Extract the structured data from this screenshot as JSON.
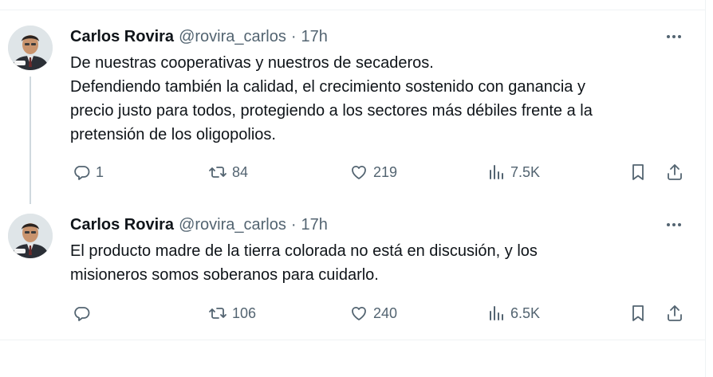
{
  "tweets": [
    {
      "author_name": "Carlos Rovira",
      "handle": "@rovira_carlos",
      "separator": "·",
      "time": "17h",
      "lines": [
        "De nuestras cooperativas y nuestros de secaderos.",
        "Defendiendo también la calidad, el crecimiento sostenido con ganancia y",
        "precio justo para todos, protegiendo a los sectores más débiles frente a la",
        "pretensión de los oligopolios."
      ],
      "replies": "1",
      "retweets": "84",
      "likes": "219",
      "views": "7.5K"
    },
    {
      "author_name": "Carlos Rovira",
      "handle": "@rovira_carlos",
      "separator": "·",
      "time": "17h",
      "lines": [
        "El producto madre de la tierra colorada no está en discusión, y los",
        "misioneros somos soberanos para cuidarlo."
      ],
      "replies": "",
      "retweets": "106",
      "likes": "240",
      "views": "6.5K"
    }
  ],
  "colors": {
    "text": "#0f1419",
    "secondary": "#536471",
    "divider": "#eff3f4",
    "thread_line": "#cfd9de"
  },
  "icons": [
    "reply-icon",
    "retweet-icon",
    "like-icon",
    "views-icon",
    "bookmark-icon",
    "share-icon",
    "more-icon"
  ]
}
